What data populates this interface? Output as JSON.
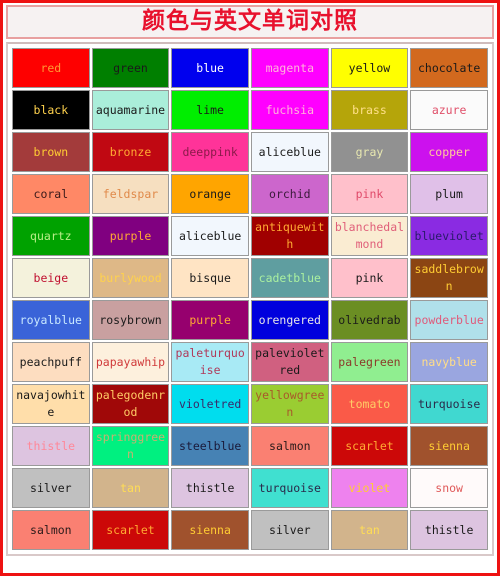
{
  "page": {
    "title": "颜色与英文单词对照",
    "frame_border_color": "#ee1111",
    "title_text_color": "#e8112d",
    "title_box_bg": "#f6f2f2"
  },
  "chart_data": {
    "type": "table",
    "title": "颜色与英文单词对照",
    "columns": 6,
    "rows": 11,
    "description": "Grid of color swatches, each labelled with its English color-name; cell background is the color and the label is drawn in a contrasting tint.",
    "cells": [
      [
        {
          "label": "red",
          "bg": "#fe0000",
          "fg": "#ff9933"
        },
        {
          "label": "green",
          "bg": "#007f00",
          "fg": "#1a1a1a"
        },
        {
          "label": "blue",
          "bg": "#0000ee",
          "fg": "#ffffff"
        },
        {
          "label": "magenta",
          "bg": "#ff00ff",
          "fg": "#ffb3d9"
        },
        {
          "label": "yellow",
          "bg": "#ffff00",
          "fg": "#1a1a1a"
        },
        {
          "label": "chocolate",
          "bg": "#d2691e",
          "fg": "#1a1a1a"
        }
      ],
      [
        {
          "label": "black",
          "bg": "#000000",
          "fg": "#ffd24d"
        },
        {
          "label": "aquamarine",
          "bg": "#aaeeda",
          "fg": "#1a1a1a"
        },
        {
          "label": "lime",
          "bg": "#00ee00",
          "fg": "#1a1a1a"
        },
        {
          "label": "fuchsia",
          "bg": "#ff00ff",
          "fg": "#ffb3d9"
        },
        {
          "label": "brass",
          "bg": "#b5a50a",
          "fg": "#ffe08a"
        },
        {
          "label": "azure",
          "bg": "#fbfbfb",
          "fg": "#e0506a"
        }
      ],
      [
        {
          "label": "brown",
          "bg": "#a33b3b",
          "fg": "#ffcc33"
        },
        {
          "label": "bronze",
          "bg": "#c00812",
          "fg": "#ffaa33"
        },
        {
          "label": "deeppink",
          "bg": "#ff3399",
          "fg": "#8b1a4a"
        },
        {
          "label": "aliceblue",
          "bg": "#f2f7fd",
          "fg": "#1a1a1a"
        },
        {
          "label": "gray",
          "bg": "#919191",
          "fg": "#e8e8b0"
        },
        {
          "label": "copper",
          "bg": "#cc11ee",
          "fg": "#ffcc99"
        }
      ],
      [
        {
          "label": "coral",
          "bg": "#ff8866",
          "fg": "#3a1a1a"
        },
        {
          "label": "feldspar",
          "bg": "#f6dfc0",
          "fg": "#e08a4a"
        },
        {
          "label": "orange",
          "bg": "#ffa500",
          "fg": "#1a1a1a"
        },
        {
          "label": "orchid",
          "bg": "#cc66cc",
          "fg": "#3a1a3a"
        },
        {
          "label": "pink",
          "bg": "#ffc0cb",
          "fg": "#e04a6a"
        },
        {
          "label": "plum",
          "bg": "#e0c0e8",
          "fg": "#1a1a1a"
        }
      ],
      [
        {
          "label": "quartz",
          "bg": "#00a200",
          "fg": "#b8ee88"
        },
        {
          "label": "purple",
          "bg": "#800080",
          "fg": "#ffaa33"
        },
        {
          "label": "aliceblue",
          "bg": "#f2f7fd",
          "fg": "#1a1a1a"
        },
        {
          "label": "antiquewith",
          "bg": "#a00000",
          "fg": "#ffaa33"
        },
        {
          "label": "blanchedalmond",
          "bg": "#faecd2",
          "fg": "#e0607a"
        },
        {
          "label": "blueviolet",
          "bg": "#8a2be2",
          "fg": "#2a1a6a"
        }
      ],
      [
        {
          "label": "beige",
          "bg": "#f4f2dc",
          "fg": "#c01030"
        },
        {
          "label": "burlywood",
          "bg": "#deb887",
          "fg": "#ffd24d"
        },
        {
          "label": "bisque",
          "bg": "#ffe4c4",
          "fg": "#1a1a1a"
        },
        {
          "label": "cadetblue",
          "bg": "#5f9ea0",
          "fg": "#aaf0a0"
        },
        {
          "label": "pink",
          "bg": "#ffc0cb",
          "fg": "#1a1a1a"
        },
        {
          "label": "saddlebrown",
          "bg": "#8b4513",
          "fg": "#ffcc33"
        }
      ],
      [
        {
          "label": "royalblue",
          "bg": "#3a63d8",
          "fg": "#c8e8ff"
        },
        {
          "label": "rosybrown",
          "bg": "#c9a0a0",
          "fg": "#1a1a1a"
        },
        {
          "label": "purple",
          "bg": "#96006e",
          "fg": "#ffaa33"
        },
        {
          "label": "orengered",
          "bg": "#0000dd",
          "fg": "#e8e8e8"
        },
        {
          "label": "olivedrab",
          "bg": "#6b8e23",
          "fg": "#1a1a1a"
        },
        {
          "label": "powderblue",
          "bg": "#b0e0ea",
          "fg": "#e05a7a"
        }
      ],
      [
        {
          "label": "peachpuff",
          "bg": "#fdddc0",
          "fg": "#1a1a1a"
        },
        {
          "label": "papayawhip",
          "bg": "#fdf0dd",
          "fg": "#d03a3a"
        },
        {
          "label": "paleturquoise",
          "bg": "#a8eaf5",
          "fg": "#b03a5a"
        },
        {
          "label": "palevioletred",
          "bg": "#d06080",
          "fg": "#1a1a1a"
        },
        {
          "label": "palegreen",
          "bg": "#90ee90",
          "fg": "#8b3a2a"
        },
        {
          "label": "navyblue",
          "bg": "#9aa6e0",
          "fg": "#ffdd88"
        }
      ],
      [
        {
          "label": "navajowhite",
          "bg": "#ffdeaa",
          "fg": "#1a1a1a"
        },
        {
          "label": "palegodenrod",
          "bg": "#a00808",
          "fg": "#ffcc66"
        },
        {
          "label": "violetred",
          "bg": "#00ddee",
          "fg": "#3a2a6a"
        },
        {
          "label": "yellowgreen",
          "bg": "#9acd32",
          "fg": "#a85a2a"
        },
        {
          "label": "tomato",
          "bg": "#fa5a48",
          "fg": "#ffcc66"
        },
        {
          "label": "turquoise",
          "bg": "#40d8d0",
          "fg": "#2a2a4a"
        }
      ],
      [
        {
          "label": "thistle",
          "bg": "#ddc4e0",
          "fg": "#ff8899"
        },
        {
          "label": "springgreen",
          "bg": "#00f080",
          "fg": "#c8b070"
        },
        {
          "label": "steelblue",
          "bg": "#4682b4",
          "fg": "#1a1a3a"
        },
        {
          "label": "salmon",
          "bg": "#fa8072",
          "fg": "#2a1a1a"
        },
        {
          "label": "scarlet",
          "bg": "#cc0808",
          "fg": "#ffaa33"
        },
        {
          "label": "sienna",
          "bg": "#a0522d",
          "fg": "#ffcc33"
        }
      ],
      [
        {
          "label": "silver",
          "bg": "#c0c0c0",
          "fg": "#1a1a1a"
        },
        {
          "label": "tan",
          "bg": "#d2b48c",
          "fg": "#ffdd55"
        },
        {
          "label": "thistle",
          "bg": "#ddc4e0",
          "fg": "#1a1a1a"
        },
        {
          "label": "turquoise",
          "bg": "#40e0d0",
          "fg": "#2a2a4a"
        },
        {
          "label": "violet",
          "bg": "#ee82ee",
          "fg": "#ffcc33"
        },
        {
          "label": "snow",
          "bg": "#fffafa",
          "fg": "#e05a5a"
        }
      ],
      [
        {
          "label": "salmon",
          "bg": "#fa8072",
          "fg": "#2a1a1a"
        },
        {
          "label": "scarlet",
          "bg": "#cc0808",
          "fg": "#ffaa33"
        },
        {
          "label": "sienna",
          "bg": "#a0522d",
          "fg": "#ffcc33"
        },
        {
          "label": "silver",
          "bg": "#c0c0c0",
          "fg": "#1a1a1a"
        },
        {
          "label": "tan",
          "bg": "#d2b48c",
          "fg": "#ffdd55"
        },
        {
          "label": "thistle",
          "bg": "#ddc4e0",
          "fg": "#1a1a1a"
        }
      ]
    ]
  }
}
